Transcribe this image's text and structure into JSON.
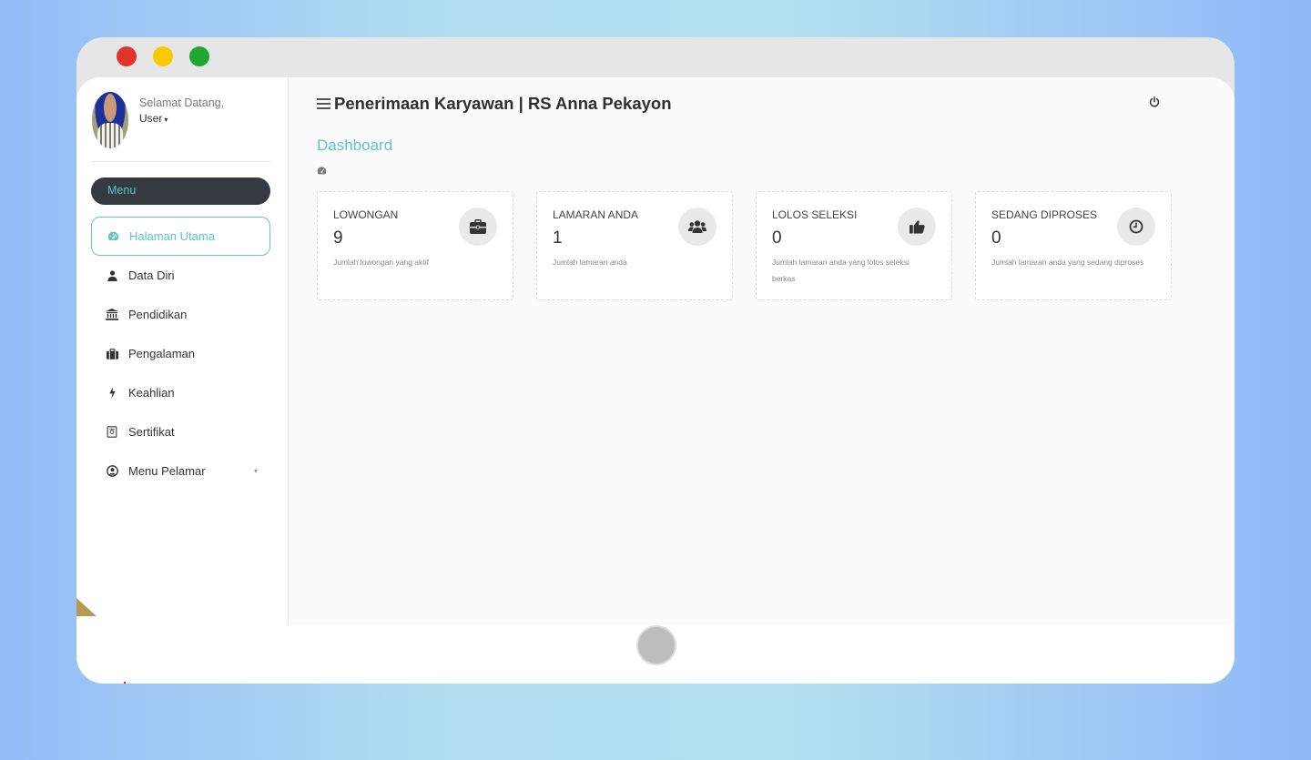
{
  "app": {
    "title": "Penerimaan Karyawan | RS Anna Pekayon"
  },
  "user": {
    "welcome": "Selamat Datang,",
    "name": "User"
  },
  "sidebar": {
    "menu_header": "Menu",
    "items": [
      {
        "label": "Halaman Utama",
        "icon": "dashboard-icon",
        "active": true
      },
      {
        "label": "Data Diri",
        "icon": "user-icon",
        "active": false
      },
      {
        "label": "Pendidikan",
        "icon": "university-icon",
        "active": false
      },
      {
        "label": "Pengalaman",
        "icon": "briefcase-icon",
        "active": false
      },
      {
        "label": "Keahlian",
        "icon": "bolt-icon",
        "active": false
      },
      {
        "label": "Sertifikat",
        "icon": "certificate-icon",
        "active": false
      },
      {
        "label": "Menu Pelamar",
        "icon": "user-circle-icon",
        "active": false
      }
    ]
  },
  "page": {
    "title": "Dashboard"
  },
  "cards": [
    {
      "title": "LOWONGAN",
      "value": "9",
      "desc": "Jumlah lowongan yang aktif",
      "icon": "briefcase-icon"
    },
    {
      "title": "LAMARAN ANDA",
      "value": "1",
      "desc": "Jumlah lamaran anda",
      "icon": "users-icon"
    },
    {
      "title": "LOLOS SELEKSI",
      "value": "0",
      "desc": "Jumlah lamaran anda yang lolos seleksi berkas",
      "icon": "thumbs-up-icon"
    },
    {
      "title": "SEDANG DIPROSES",
      "value": "0",
      "desc": "Jumlah lamaran anda yang sedang diproses",
      "icon": "clock-icon"
    }
  ],
  "colors": {
    "accent": "#5ec4c4",
    "menu_header_bg": "#343a40"
  }
}
